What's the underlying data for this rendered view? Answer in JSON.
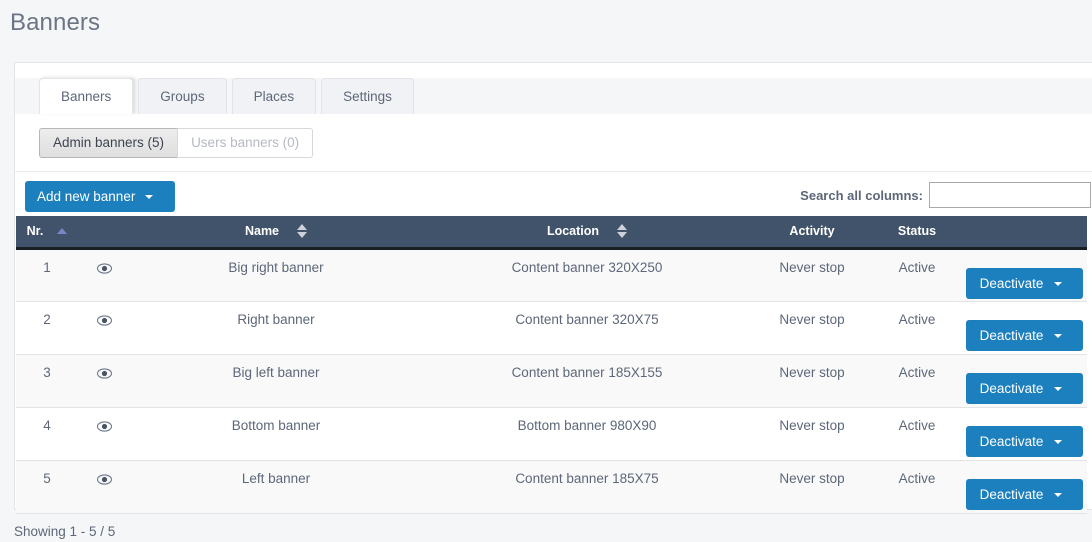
{
  "page": {
    "title": "Banners",
    "showing_text": "Showing 1 - 5 / 5"
  },
  "tabs": [
    {
      "label": "Banners",
      "active": true
    },
    {
      "label": "Groups",
      "active": false
    },
    {
      "label": "Places",
      "active": false
    },
    {
      "label": "Settings",
      "active": false
    }
  ],
  "subtabs": [
    {
      "label": "Admin banners (5)",
      "active": true
    },
    {
      "label": "Users banners (0)",
      "active": false
    }
  ],
  "toolbar": {
    "add_label": "Add new banner",
    "search_label": "Search all columns:",
    "search_value": "",
    "search_placeholder": ""
  },
  "table": {
    "columns": [
      {
        "label": "Nr.",
        "sort": "asc"
      },
      {
        "label": "",
        "sort": "none"
      },
      {
        "label": "Name",
        "sort": "both"
      },
      {
        "label": "Location",
        "sort": "both"
      },
      {
        "label": "Activity",
        "sort": "none"
      },
      {
        "label": "Status",
        "sort": "none"
      },
      {
        "label": "",
        "sort": "none"
      }
    ],
    "rows": [
      {
        "nr": "1",
        "icon": "eye-icon",
        "name": "Big right banner",
        "location": "Content banner 320X250",
        "activity": "Never stop",
        "status": "Active",
        "action": "Deactivate"
      },
      {
        "nr": "2",
        "icon": "eye-icon",
        "name": "Right banner",
        "location": "Content banner 320X75",
        "activity": "Never stop",
        "status": "Active",
        "action": "Deactivate"
      },
      {
        "nr": "3",
        "icon": "eye-icon",
        "name": "Big left banner",
        "location": "Content banner 185X155",
        "activity": "Never stop",
        "status": "Active",
        "action": "Deactivate"
      },
      {
        "nr": "4",
        "icon": "eye-icon",
        "name": "Bottom banner",
        "location": "Bottom banner 980X90",
        "activity": "Never stop",
        "status": "Active",
        "action": "Deactivate"
      },
      {
        "nr": "5",
        "icon": "eye-icon",
        "name": "Left banner",
        "location": "Content banner 185X75",
        "activity": "Never stop",
        "status": "Active",
        "action": "Deactivate"
      }
    ]
  },
  "colors": {
    "accent_blue": "#1c7fbe",
    "header_dark": "#41536a",
    "text_gray": "#5d6779",
    "sort_active": "#7f83c4"
  }
}
